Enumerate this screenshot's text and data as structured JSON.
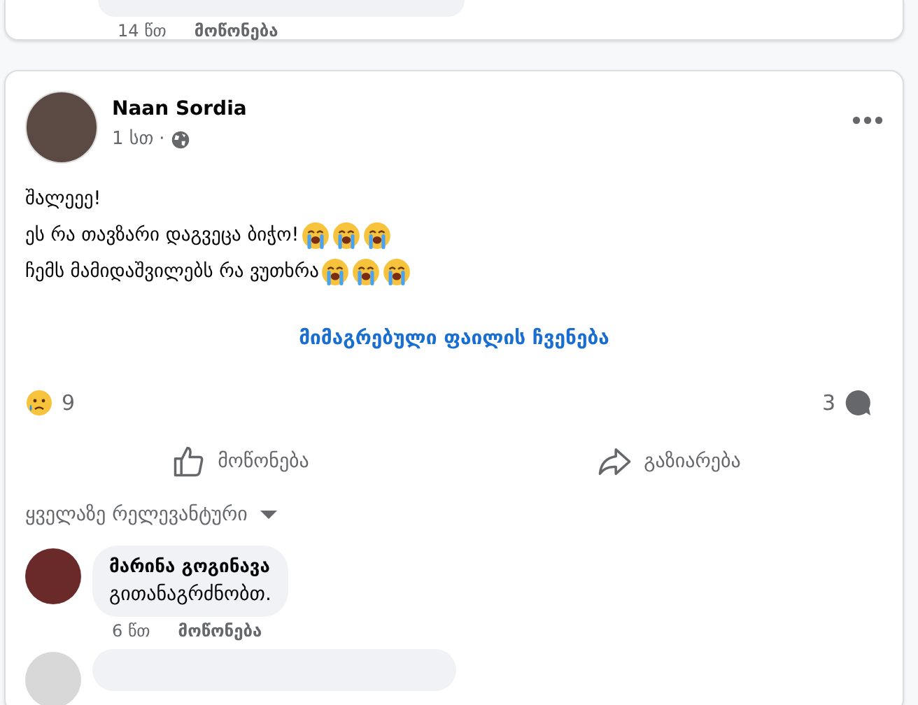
{
  "previous_comment": {
    "time": "14 წთ",
    "like": "მოწონება"
  },
  "post": {
    "author": "Naan Sordia",
    "time": "1 სთ",
    "separator": "·",
    "lines": [
      {
        "text": "შალეეე!"
      },
      {
        "text": "ეს რა თავზარი დაგვეცა  ბიჭო!",
        "emojis": [
          {
            "kind": "crying"
          },
          {
            "kind": "crying"
          },
          {
            "kind": "crying"
          }
        ]
      },
      {
        "text": "ჩემს მამიდაშვილებს რა ვუთხრა",
        "emojis": [
          {
            "kind": "crying"
          },
          {
            "kind": "crying"
          },
          {
            "kind": "crying"
          }
        ]
      }
    ],
    "attachment_link": "მიმაგრებული ფაილის ჩვენება",
    "reaction_count": "9",
    "comment_count": "3",
    "actions": [
      {
        "kind": "like",
        "label": "მოწონება"
      },
      {
        "kind": "share",
        "label": "გაზიარება"
      }
    ],
    "sort": "ყველაზე რელევანტური",
    "comments": [
      {
        "author": "მარინა გოგინავა",
        "text": "გითანაგრძნობთ.",
        "time": "6 წთ",
        "like": "მოწონება"
      }
    ]
  }
}
